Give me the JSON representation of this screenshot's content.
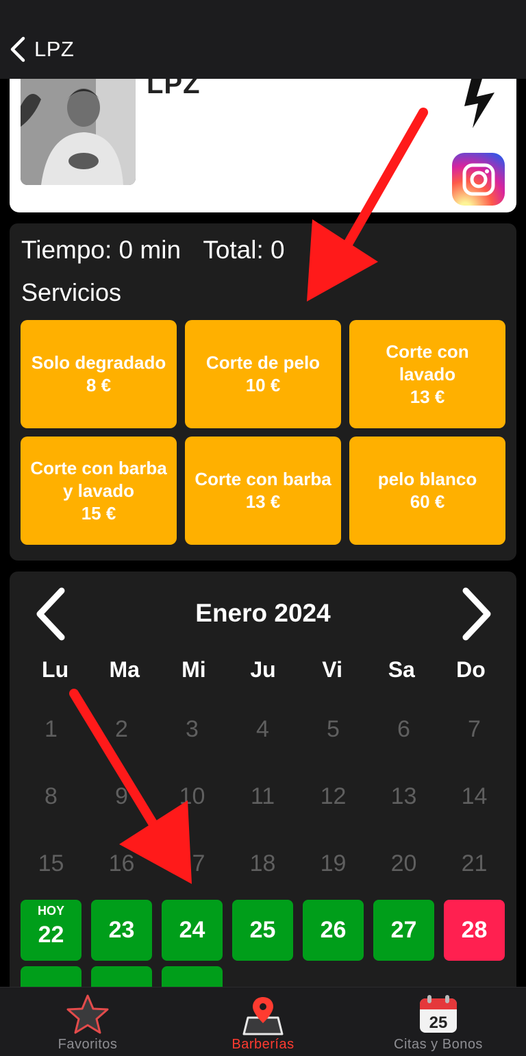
{
  "nav": {
    "title": "LPZ"
  },
  "profile": {
    "name": "LPZ"
  },
  "summary": {
    "time": "Tiempo: 0 min",
    "total": "Total: 0"
  },
  "services_title": "Servicios",
  "services": [
    {
      "name": "Solo degradado",
      "price": "8 €"
    },
    {
      "name": "Corte de pelo",
      "price": "10 €"
    },
    {
      "name": "Corte con lavado",
      "price": "13 €"
    },
    {
      "name": "Corte con barba y lavado",
      "price": "15 €"
    },
    {
      "name": "Corte con barba",
      "price": "13 €"
    },
    {
      "name": "pelo blanco",
      "price": "60 €"
    }
  ],
  "calendar": {
    "month": "Enero 2024",
    "weekdays": [
      "Lu",
      "Ma",
      "Mi",
      "Ju",
      "Vi",
      "Sa",
      "Do"
    ],
    "today_label": "HOY",
    "past_days": [
      "1",
      "2",
      "3",
      "4",
      "5",
      "6",
      "7",
      "8",
      "9",
      "10",
      "11",
      "12",
      "13",
      "14",
      "15",
      "16",
      "17",
      "18",
      "19",
      "20",
      "21"
    ],
    "available_days": [
      "22",
      "23",
      "24",
      "25",
      "26",
      "27"
    ],
    "closed_days": [
      "28"
    ]
  },
  "tabs": [
    {
      "label": "Favoritos",
      "icon": "star-icon"
    },
    {
      "label": "Barberías",
      "icon": "map-pin-icon"
    },
    {
      "label": "Citas y Bonos",
      "icon": "calendar-icon",
      "calendar_number": "25"
    }
  ],
  "colors": {
    "service_button": "#ffb000",
    "available_day": "#009e1a",
    "closed_day": "#ff2050",
    "active_tab": "#ff3b30",
    "annotation_arrow": "#ff1a1a"
  }
}
